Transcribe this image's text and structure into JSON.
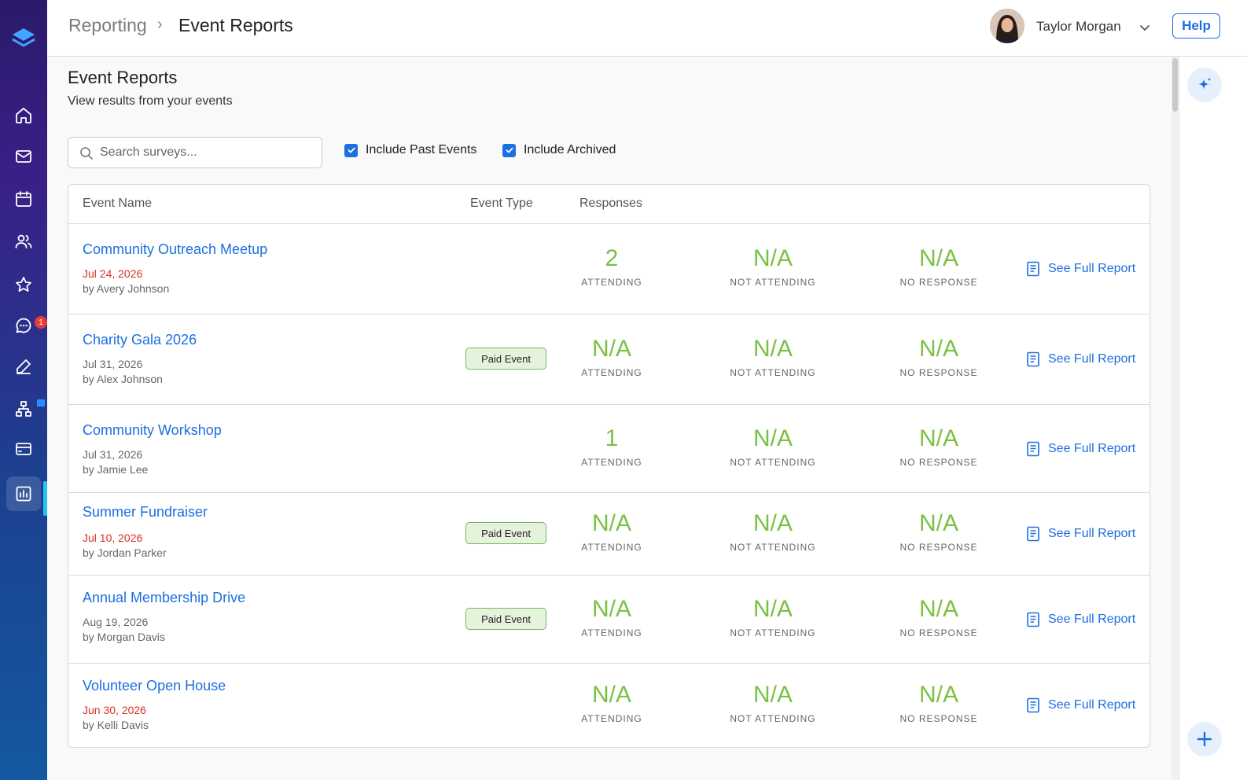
{
  "header": {
    "breadcrumb_root": "Reporting",
    "breadcrumb_separator": "›",
    "breadcrumb_current": "Event Reports",
    "user_name": "Taylor Morgan",
    "help_label": "Help"
  },
  "nav": {
    "items": [
      "home-icon",
      "mail-icon",
      "calendar-icon",
      "users-icon",
      "star-icon",
      "chat-icon",
      "edit-icon",
      "org-chart-icon",
      "card-icon",
      "reports-icon"
    ],
    "chat_badge": "1",
    "active": "reports-icon"
  },
  "page": {
    "title": "Event Reports",
    "subtitle": "View results from your events"
  },
  "filters": {
    "search_placeholder": "Search surveys...",
    "include_past_label": "Include Past Events",
    "include_past_checked": true,
    "include_archived_label": "Include Archived",
    "include_archived_checked": true
  },
  "table": {
    "headers": {
      "name": "Event Name",
      "type": "Event Type",
      "responses": "Responses"
    },
    "metric_labels": {
      "attending": "ATTENDING",
      "not_attending": "NOT ATTENDING",
      "no_response": "NO RESPONSE"
    },
    "report_link_label": "See Full Report",
    "rows": [
      {
        "name": "Community Outreach Meetup",
        "date": "Jul 24, 2026",
        "date_red": true,
        "by": "by Avery Johnson",
        "type": "",
        "attending": "2",
        "not_attending": "N/A",
        "no_response": "N/A"
      },
      {
        "name": "Charity Gala 2026",
        "date": "Jul 31, 2026",
        "date_red": false,
        "by": "by Alex Johnson",
        "type": "Paid Event",
        "attending": "N/A",
        "not_attending": "N/A",
        "no_response": "N/A"
      },
      {
        "name": "Community Workshop",
        "date": "Jul 31, 2026",
        "date_red": false,
        "by": "by Jamie Lee",
        "type": "",
        "attending": "1",
        "not_attending": "N/A",
        "no_response": "N/A"
      },
      {
        "name": "Summer Fundraiser",
        "date": "Jul 10, 2026",
        "date_red": true,
        "by": "by Jordan Parker",
        "type": "Paid Event",
        "attending": "N/A",
        "not_attending": "N/A",
        "no_response": "N/A"
      },
      {
        "name": "Annual Membership Drive",
        "date": "Aug 19, 2026",
        "date_red": false,
        "by": "by Morgan Davis",
        "type": "Paid Event",
        "attending": "N/A",
        "not_attending": "N/A",
        "no_response": "N/A"
      },
      {
        "name": "Volunteer Open House",
        "date": "Jun 30, 2026",
        "date_red": true,
        "by": "by Kelli Davis",
        "type": "",
        "attending": "N/A",
        "not_attending": "N/A",
        "no_response": "N/A"
      }
    ]
  },
  "colors": {
    "accent": "#1c6fe0",
    "metric_green": "#7ac143",
    "overdue_red": "#d93025",
    "badge_bg": "#e6f3dc",
    "badge_border": "#74b75d"
  }
}
